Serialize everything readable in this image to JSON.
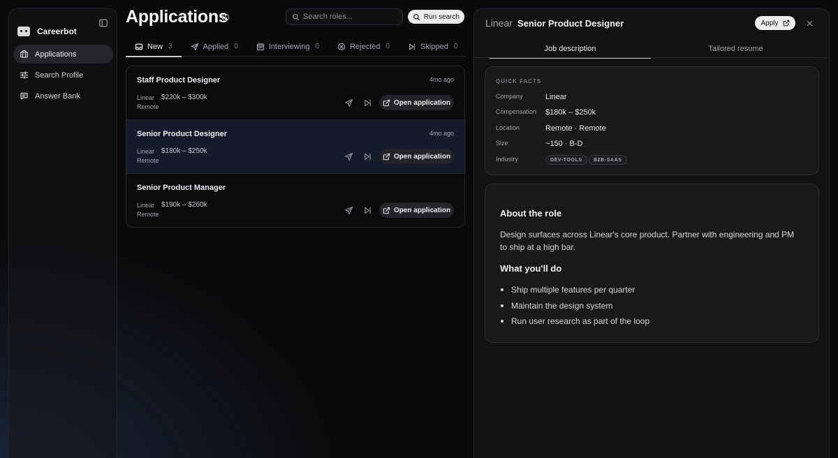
{
  "sidebar": {
    "brand": "Careerbot",
    "items": [
      {
        "label": "Applications",
        "icon": "briefcase-icon",
        "active": true
      },
      {
        "label": "Search Profile",
        "icon": "sliders-icon",
        "active": false
      },
      {
        "label": "Answer Bank",
        "icon": "message-icon",
        "active": false
      }
    ]
  },
  "header": {
    "title": "Applications",
    "search_placeholder": "Search roles...",
    "run_search_label": "Run search"
  },
  "tabs": [
    {
      "label": "New",
      "count": "3",
      "active": true
    },
    {
      "label": "Applied",
      "count": "0",
      "active": false
    },
    {
      "label": "Interviewing",
      "count": "0",
      "active": false
    },
    {
      "label": "Rejected",
      "count": "0",
      "active": false
    },
    {
      "label": "Skipped",
      "count": "0",
      "active": false
    }
  ],
  "applications": [
    {
      "title": "Staff Product Designer",
      "time": "4mo ago",
      "company": "Linear",
      "salary": "$220k – $300k",
      "location": "Remote",
      "action": "Open application",
      "selected": false
    },
    {
      "title": "Senior Product Designer",
      "time": "4mo ago",
      "company": "Linear",
      "salary": "$180k – $250k",
      "location": "Remote",
      "action": "Open application",
      "selected": true
    },
    {
      "title": "Senior Product Manager",
      "time": "",
      "company": "Linear",
      "salary": "$190k – $260k",
      "location": "Remote",
      "action": "Open application",
      "selected": false
    }
  ],
  "detail": {
    "company": "Linear",
    "title": "Senior Product Designer",
    "apply_label": "Apply",
    "tabs": [
      "Job description",
      "Tailored resume"
    ],
    "quick_facts_label": "QUICK FACTS",
    "facts": [
      {
        "key": "Company",
        "value": "Linear"
      },
      {
        "key": "Compensation",
        "value": "$180k – $250k"
      },
      {
        "key": "Location",
        "value": "Remote · Remote"
      },
      {
        "key": "Size",
        "value": "~150 · B-D"
      }
    ],
    "industry_label": "Industry",
    "industry_tags": [
      "DEV-TOOLS",
      "B2B-SAAS"
    ],
    "about_heading": "About the role",
    "about_text": "Design surfaces across Linear's core product. Partner with engineering and PM to ship at a high bar.",
    "todo_heading": "What you'll do",
    "todo_items": [
      "Ship multiple features per quarter",
      "Maintain the design system",
      "Run user research as part of the loop"
    ]
  }
}
